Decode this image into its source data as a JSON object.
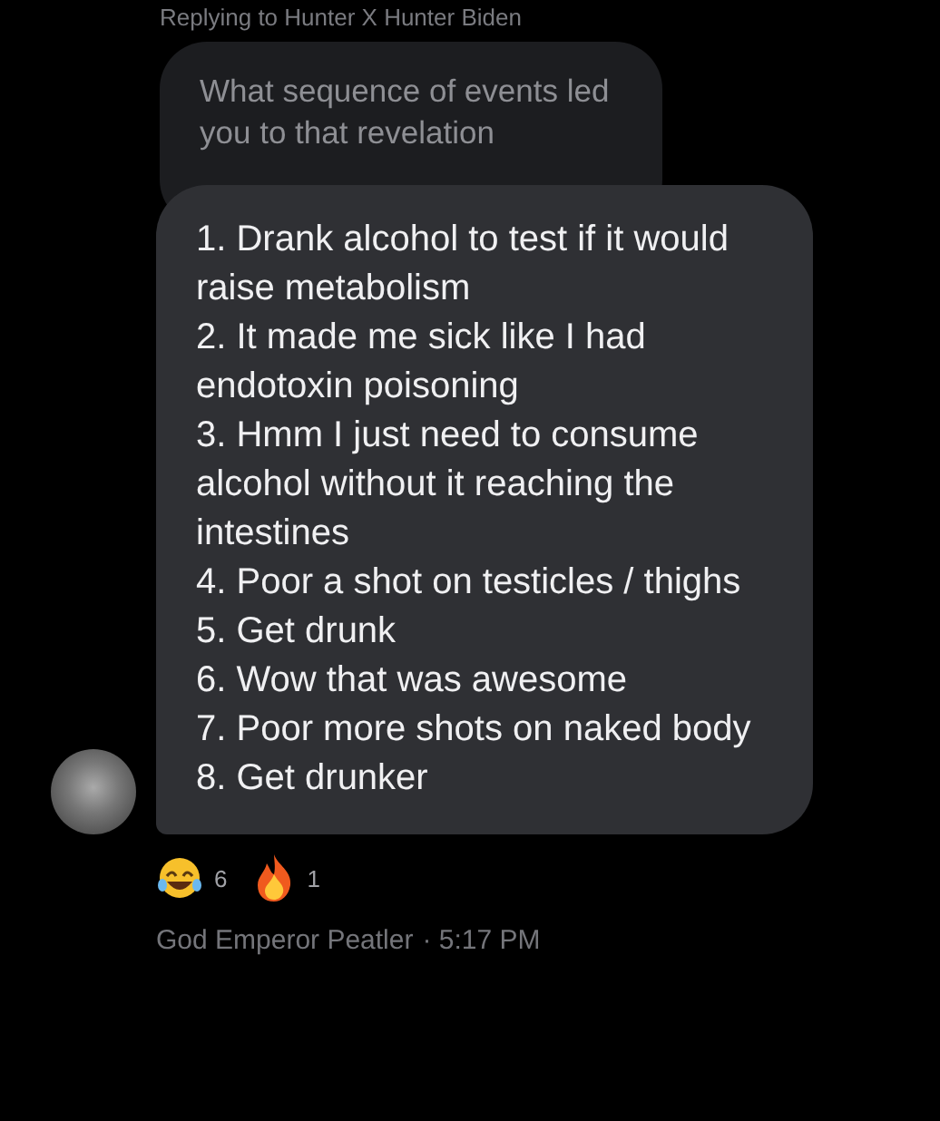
{
  "reply_context": "Replying to Hunter X Hunter Biden",
  "quoted_message": {
    "text": "What sequence of events led you to that revelation"
  },
  "message": {
    "lines": [
      "1. Drank alcohol to test if it would raise metabolism",
      "2. It made me sick like I had endotoxin poisoning",
      "3. Hmm I just need to consume alcohol without it reaching the intestines",
      "4. Poor a shot on testicles / thighs",
      "5. Get drunk",
      "6. Wow that was awesome",
      "7. Poor more shots on naked body",
      "8. Get drunker"
    ]
  },
  "reactions": [
    {
      "kind": "laughing",
      "count": "6"
    },
    {
      "kind": "fire",
      "count": "1"
    }
  ],
  "footer": {
    "sender": "God Emperor Peatler",
    "time": "· 5:17 PM"
  }
}
